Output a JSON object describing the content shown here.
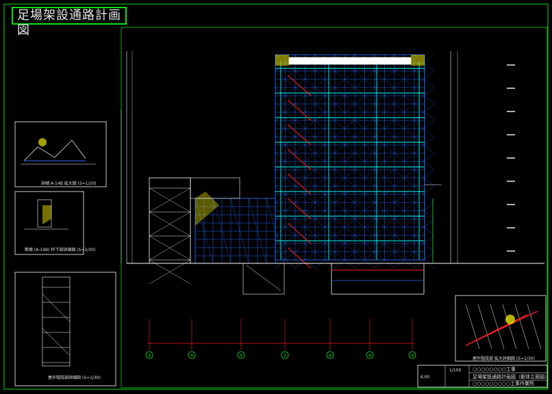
{
  "title": "足場架設通路計画図",
  "colors": {
    "background": "#000000",
    "frame": "#10e010",
    "scaffold": "#2a6cff",
    "cyan": "#00ffff",
    "red": "#ff2020",
    "green": "#1ee01e",
    "white": "#e0e0e0",
    "yellow": "#e8e000"
  },
  "grid_markers": [
    "③",
    "④",
    "⑤",
    "⑦",
    "⑧",
    "⑨",
    "⑩"
  ],
  "detail_captions": {
    "detail_a": "詳細 A-14B 拡大図 (S=1/20)",
    "detail_b": "断面 (A-14B) 枠下部詳細図 (S=1/30)",
    "detail_c": "屋外階段部詳細図 (S=1/30)",
    "detail_d": "屋外階段部 拡大詳細図 (S=1/30)"
  },
  "title_block": {
    "project": "○○○○○○○○工事",
    "drawing": "足場架設通路計画図（躯体立面図）",
    "company": "○○○○○○○○○工事作業所",
    "scale": "1/100",
    "drawing_no": "K-00"
  }
}
